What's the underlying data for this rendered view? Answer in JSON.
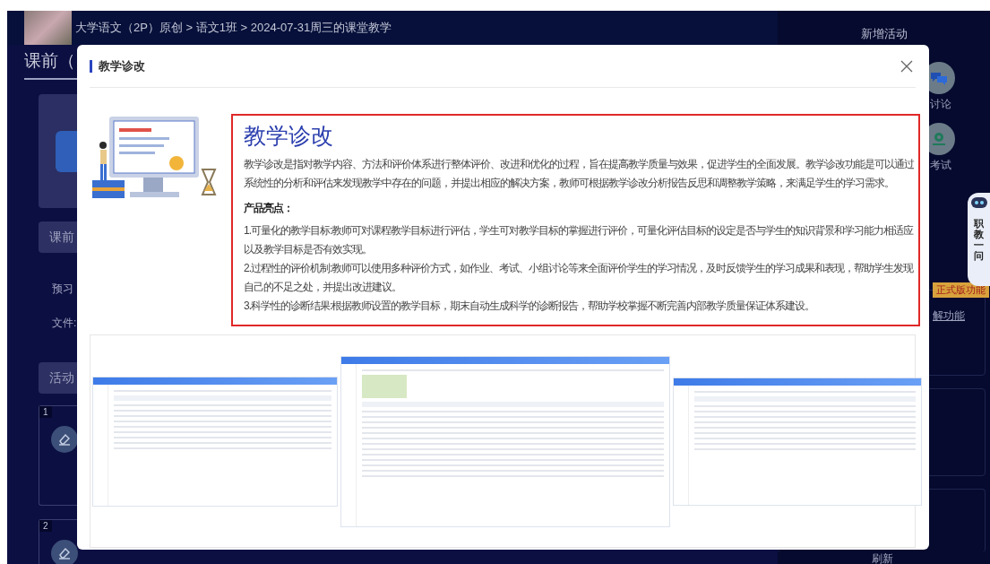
{
  "header": {
    "breadcrumb": "大学语文（2P）原创 > 语文1班 > 2024-07-31周三的课堂教学"
  },
  "left_panel": {
    "heading": "课前（",
    "items": [
      {
        "kind": "button",
        "label": "课前"
      },
      {
        "kind": "text",
        "label": "预习"
      },
      {
        "kind": "text",
        "label": "文件:"
      },
      {
        "kind": "button",
        "label": "活动"
      },
      {
        "kind": "card",
        "label": "1"
      },
      {
        "kind": "card",
        "label": "2"
      }
    ]
  },
  "right_panel": {
    "title": "新增活动",
    "activities": [
      {
        "kind": "discussion",
        "label": "讨论"
      },
      {
        "kind": "exam",
        "label": "考试"
      }
    ],
    "badge": "正式版功能",
    "link": "解功能",
    "refresh": "刷新"
  },
  "assistant": {
    "label": "职教一问"
  },
  "modal": {
    "title": "教学诊改",
    "intro": {
      "heading": "教学诊改",
      "description": "教学诊改是指对教学内容、方法和评价体系进行整体评价、改进和优化的过程，旨在提高教学质量与效果，促进学生的全面发展。教学诊改功能是可以通过系统性的分析和评估来发现教学中存在的问题，并提出相应的解决方案，教师可根据教学诊改分析报告反思和调整教学策略，来满足学生的学习需求。",
      "highlights_title": "产品亮点：",
      "highlights": [
        "1.可量化的教学目标:教师可对课程教学目标进行评估，学生可对教学目标的掌握进行评价，可量化评估目标的设定是否与学生的知识背景和学习能力相适应以及教学目标是否有效实现。",
        "2.过程性的评价机制:教师可以使用多种评价方式，如作业、考试、小组讨论等来全面评价学生的学习情况，及时反馈学生的学习成果和表现，帮助学生发现自己的不足之处，并提出改进建议。",
        "3.科学性的诊断结果:根据教师设置的教学目标，期末自动生成科学的诊断报告，帮助学校掌握不断完善内部教学质量保证体系建设。"
      ]
    }
  }
}
